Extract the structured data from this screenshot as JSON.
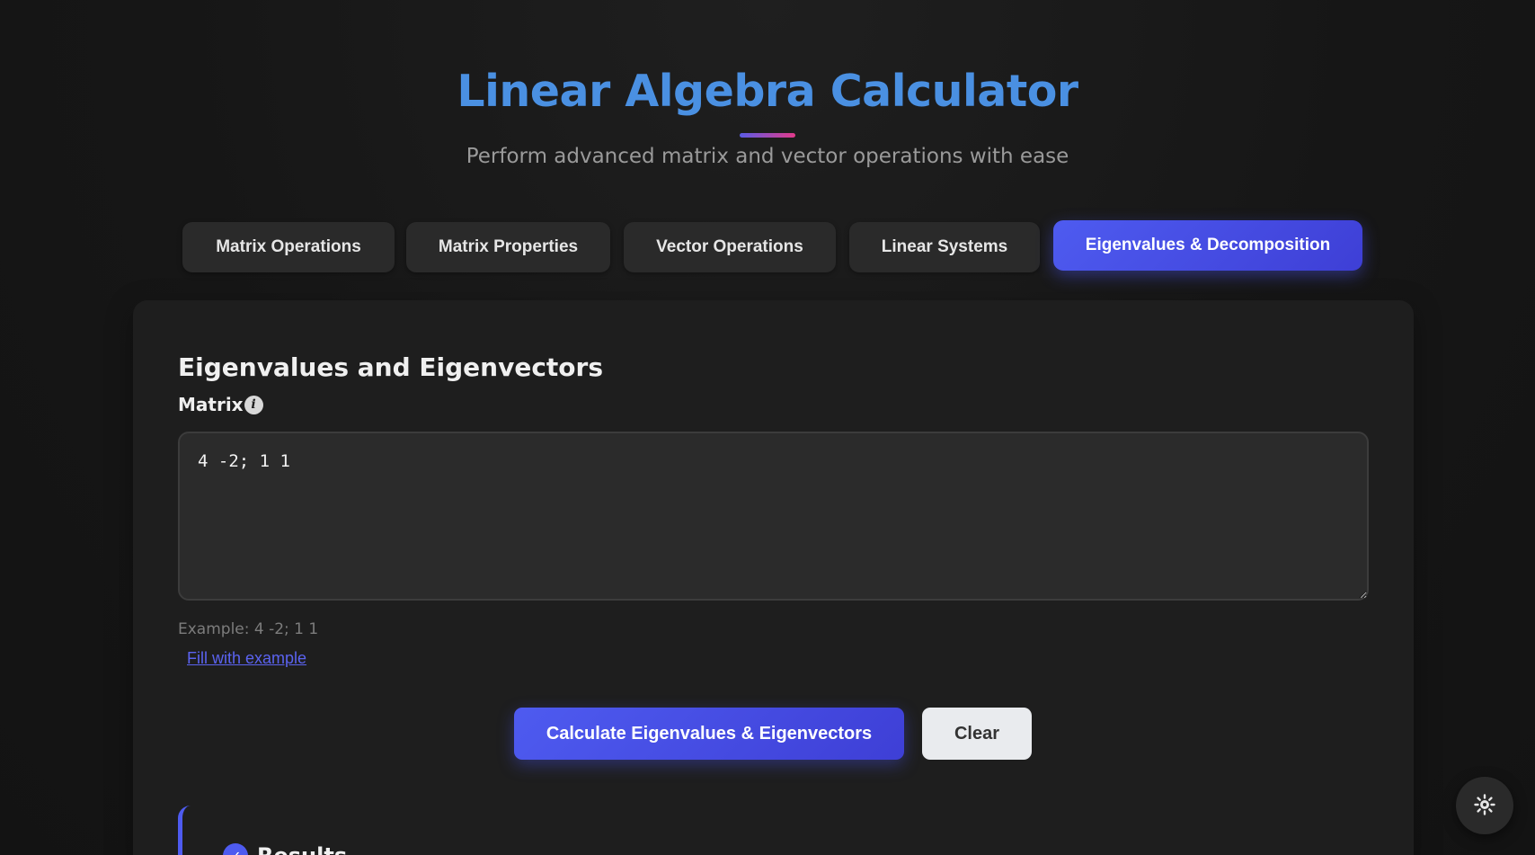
{
  "header": {
    "title": "Linear Algebra Calculator",
    "subtitle": "Perform advanced matrix and vector operations with ease"
  },
  "tabs": [
    {
      "label": "Matrix Operations",
      "active": false
    },
    {
      "label": "Matrix Properties",
      "active": false
    },
    {
      "label": "Vector Operations",
      "active": false
    },
    {
      "label": "Linear Systems",
      "active": false
    },
    {
      "label": "Eigenvalues & Decomposition",
      "active": true
    }
  ],
  "card": {
    "section_title": "Eigenvalues and Eigenvectors",
    "matrix_label": "Matrix",
    "info_icon": "i",
    "matrix_value": "4 -2; 1 1",
    "example_text": "Example: 4 -2; 1 1",
    "fill_link": "Fill with example",
    "calculate_label": "Calculate Eigenvalues & Eigenvectors",
    "clear_label": "Clear",
    "results_label": "Results",
    "results_icon": "check-icon"
  },
  "theme_toggle": {
    "icon": "sun-icon"
  },
  "colors": {
    "accent": "#4e5bf0",
    "title": "#4a90e2",
    "background": "#151515",
    "card": "#1e1e1e"
  }
}
